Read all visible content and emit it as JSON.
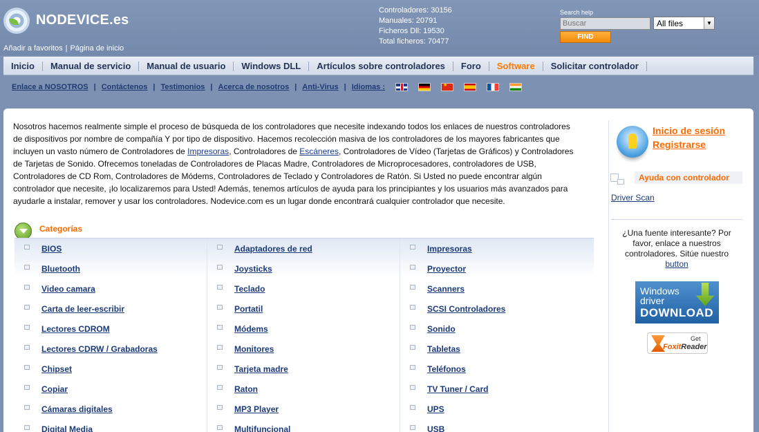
{
  "header": {
    "logo_text": "NODEVICE.es",
    "top_links": [
      "Añadir a favoritos",
      "Página de inicio"
    ],
    "stats": [
      "Controladores: 30156",
      "Manuales: 20791",
      "Ficheros Dll: 19530",
      "Total ficheros: 70477"
    ],
    "search": {
      "label": "Search help",
      "placeholder": "Buscar",
      "scope_selected": "All files",
      "find_label": "FIND"
    }
  },
  "main_nav": [
    "Inicio",
    "Manual de servicio",
    "Manual de usuario",
    "Windows DLL",
    "Artículos sobre controladores",
    "Foro",
    "Software",
    "Solicitar controlador"
  ],
  "main_nav_active": "Software",
  "sub_nav": {
    "links": [
      "Enlace a NOSOTROS",
      "Contáctenos",
      "Testimonios",
      "Acerca de nosotros",
      "Anti-Virus",
      "Idiomas :"
    ],
    "languages": [
      "english-flag-icon",
      "german-flag-icon",
      "chinese-flag-icon",
      "spanish-flag-icon",
      "french-flag-icon",
      "indian-flag-icon"
    ]
  },
  "intro": {
    "p1": "Nosotros hacemos realmente simple el proceso de búsqueda de los controladores que necesite indexando todos los enlaces de nuestros controladores de dispositivos por nombre de compañía Y por tipo de dispositivo. Hacemos recolección masiva de los controladores de los mayores fabricantes que incluyen un vasto número de Controladores de ",
    "kw1": "Impresoras",
    "p2": ", Controladores de ",
    "kw2": "Escáneres",
    "p3": ", Controladores de Vídeo (Tarjetas de Gráficos) y Controladores de Tarjetas de Sonido. Ofrecemos toneladas de Controladores de Placas Madre, Controladores de Microprocesadores, controladores de USB, Controladores de CD Rom, Controladores de Módems, Controladores de Teclado y Controladores de Ratón. Si Usted no puede encontrar algún controlador que necesite, ¡lo localizaremos para Usted! Además, tenemos artículos de ayuda para los principiantes y los usuarios más avanzados para ayudarle a instalar, remover y usar los controladores. Nodevice.com es un lugar donde encontrará cualquier controlador que necesite."
  },
  "categories": {
    "title": "Categorías",
    "col1": [
      "BIOS",
      "Bluetooth",
      "Video camara",
      "Carta de leer-escribir",
      "Lectores CDROM",
      "Lectores CDRW / Grabadoras",
      "Chipset",
      "Copiar",
      "Cámaras digitales",
      "Digital Media"
    ],
    "col2": [
      "Adaptadores de red",
      "Joysticks",
      "Teclado",
      "Portatil",
      "Módems",
      "Monitores",
      "Tarjeta madre",
      "Raton",
      "MP3 Player",
      "Multifuncional"
    ],
    "col3": [
      "Impresoras",
      "Proyector",
      "Scanners",
      "SCSI Controladores",
      "Sonido",
      "Tabletas",
      "Teléfonos",
      "TV Tuner / Card",
      "UPS",
      "USB"
    ]
  },
  "sidebar": {
    "login": "Inicio de sesión",
    "register": "Registrarse",
    "help_title": "Ayuda con controlador",
    "driver_scan": "Driver Scan",
    "promo_text": "¿Una fuente interesante? Por favor, enlace a nuestros controladores. Sitúe nuestro ",
    "promo_link": "button",
    "win_badge": [
      "Windows",
      "driver",
      "DOWNLOAD"
    ],
    "foxit_get": "Get",
    "foxit_name": "Foxit",
    "foxit_reader": "Reader"
  },
  "colors": {
    "accent": "#ff6a00",
    "link": "#1c3a78",
    "header_bg": "#7d92b3"
  }
}
